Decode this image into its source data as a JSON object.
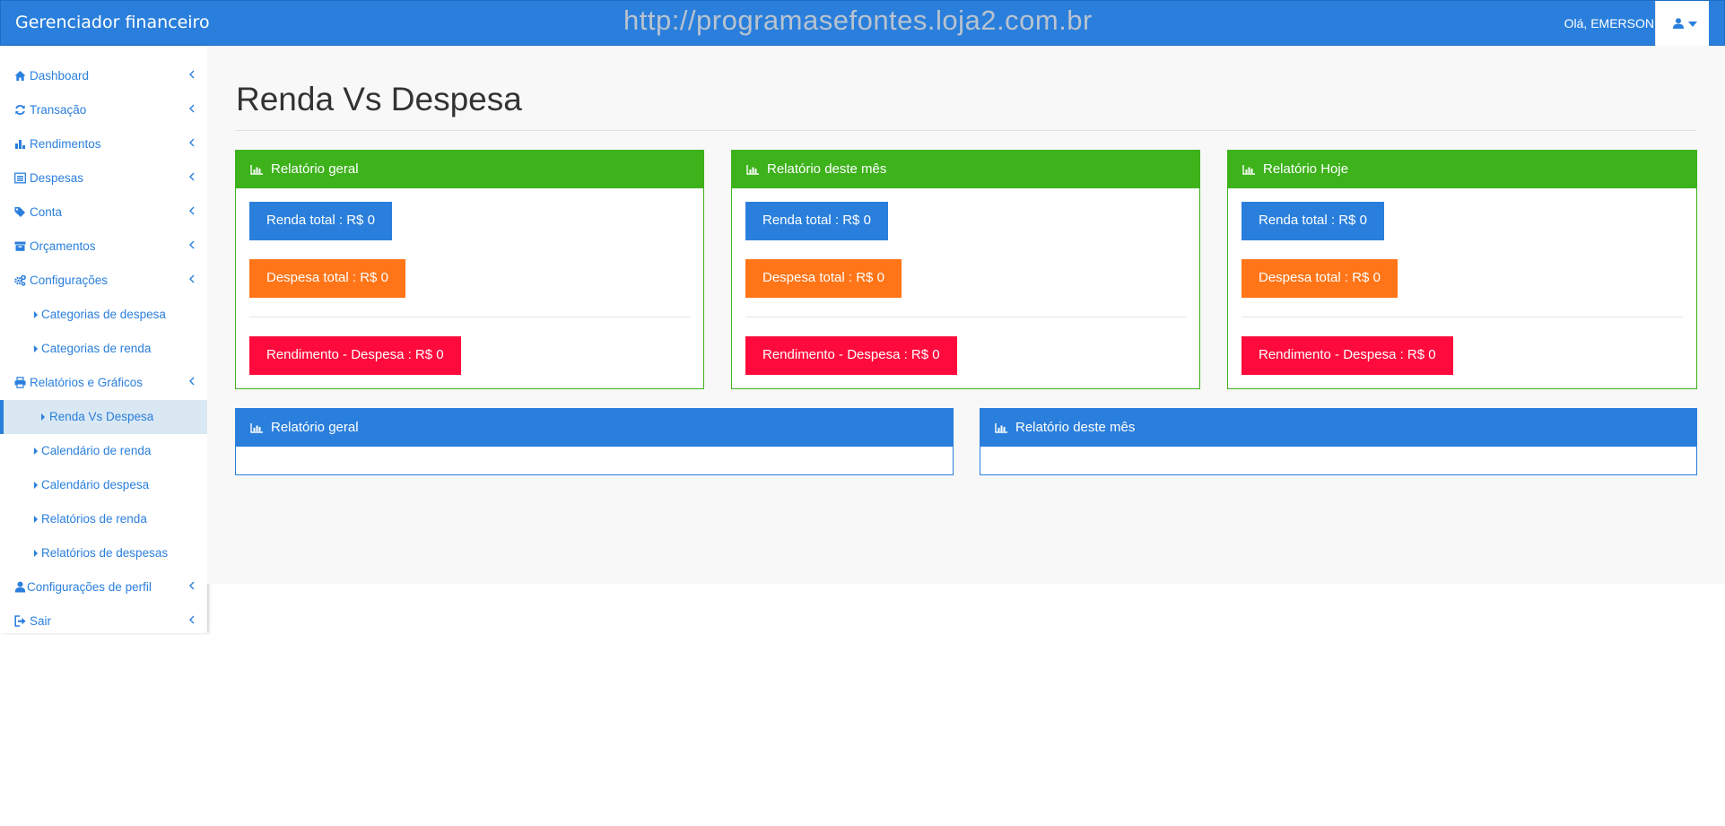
{
  "navbar": {
    "brand": "Gerenciador financeiro",
    "watermark": "http://programasefontes.loja2.com.br",
    "greeting": "Olá, EMERSON",
    "user_icon": "user-icon"
  },
  "sidebar": {
    "items": [
      {
        "label": "Dashboard",
        "icon": "home-icon"
      },
      {
        "label": "Transação",
        "icon": "refresh-icon"
      },
      {
        "label": "Rendimentos",
        "icon": "bar-chart-icon"
      },
      {
        "label": "Despesas",
        "icon": "list-icon"
      },
      {
        "label": "Conta",
        "icon": "tags-icon"
      },
      {
        "label": "Orçamentos",
        "icon": "archive-icon"
      },
      {
        "label": "Configurações",
        "icon": "cogs-icon"
      },
      {
        "label": "Categorias de despesa",
        "sub": true
      },
      {
        "label": "Categorias de renda",
        "sub": true
      },
      {
        "label": "Relatórios e Gráficos",
        "icon": "print-icon"
      },
      {
        "label": "Renda Vs Despesa",
        "sub": true,
        "active": true
      },
      {
        "label": "Calendário de renda",
        "sub": true
      },
      {
        "label": "Calendário despesa",
        "sub": true
      },
      {
        "label": "Relatórios de renda",
        "sub": true
      },
      {
        "label": "Relatórios de despesas",
        "sub": true
      },
      {
        "label": "Configurações de perfil",
        "icon": "user-icon"
      },
      {
        "label": "Sair",
        "icon": "sign-out-icon"
      }
    ]
  },
  "main": {
    "page_title": "Renda Vs Despesa",
    "summary_panels": [
      {
        "title": "Relatório geral",
        "income": "Renda total : R$ 0",
        "expense": "Despesa total : R$ 0",
        "balance": "Rendimento - Despesa : R$ 0"
      },
      {
        "title": "Relatório deste mês",
        "income": "Renda total : R$ 0",
        "expense": "Despesa total : R$ 0",
        "balance": "Rendimento - Despesa : R$ 0"
      },
      {
        "title": "Relatório Hoje",
        "income": "Renda total : R$ 0",
        "expense": "Despesa total : R$ 0",
        "balance": "Rendimento - Despesa : R$ 0"
      }
    ],
    "chart_panels": [
      {
        "title": "Relatório geral"
      },
      {
        "title": "Relatório deste mês"
      }
    ]
  },
  "colors": {
    "primary": "#2a7fdc",
    "success": "#3db21b",
    "warning": "#ff7518",
    "danger": "#ff0a3c"
  }
}
